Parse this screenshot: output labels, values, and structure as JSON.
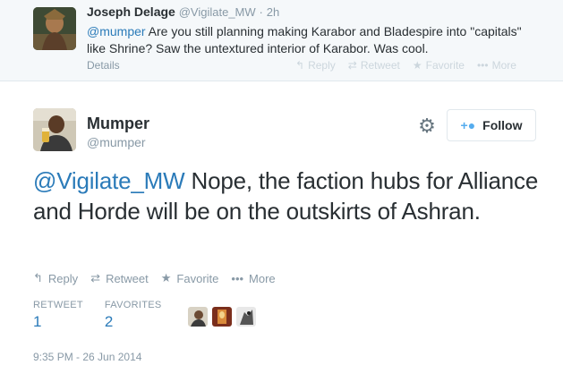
{
  "parent_tweet": {
    "fullname": "Joseph Delage",
    "handle": "@Vigilate_MW",
    "separator": "·",
    "time": "2h",
    "mention": "@mumper",
    "text": " Are you still planning making Karabor and Bladespire into \"capitals\" like Shrine? Saw the untextured interior of Karabor. Was cool.",
    "details_label": "Details",
    "actions": [
      {
        "icon": "reply-icon",
        "glyph": "↰",
        "label": "Reply"
      },
      {
        "icon": "retweet-icon",
        "glyph": "⇄",
        "label": "Retweet"
      },
      {
        "icon": "favorite-icon",
        "glyph": "★",
        "label": "Favorite"
      },
      {
        "icon": "more-icon",
        "glyph": "•••",
        "label": "More"
      }
    ]
  },
  "tweet": {
    "fullname": "Mumper",
    "handle": "@mumper",
    "follow_label": "Follow",
    "mention": "@Vigilate_MW",
    "text": " Nope, the faction hubs for Alliance and Horde will be on the outskirts of Ashran.",
    "actions": [
      {
        "icon": "reply-icon",
        "glyph": "↰",
        "label": "Reply"
      },
      {
        "icon": "retweet-icon",
        "glyph": "⇄",
        "label": "Retweet"
      },
      {
        "icon": "favorite-icon",
        "glyph": "★",
        "label": "Favorite"
      },
      {
        "icon": "more-icon",
        "glyph": "•••",
        "label": "More"
      }
    ],
    "stats": {
      "retweets_label": "RETWEET",
      "retweets": "1",
      "favorites_label": "FAVORITES",
      "favorites": "2"
    },
    "timestamp": "9:35 PM - 26 Jun 2014"
  },
  "colors": {
    "link": "#2b7bb9",
    "muted": "#8899a6",
    "text": "#292f33",
    "accent": "#55acee"
  }
}
